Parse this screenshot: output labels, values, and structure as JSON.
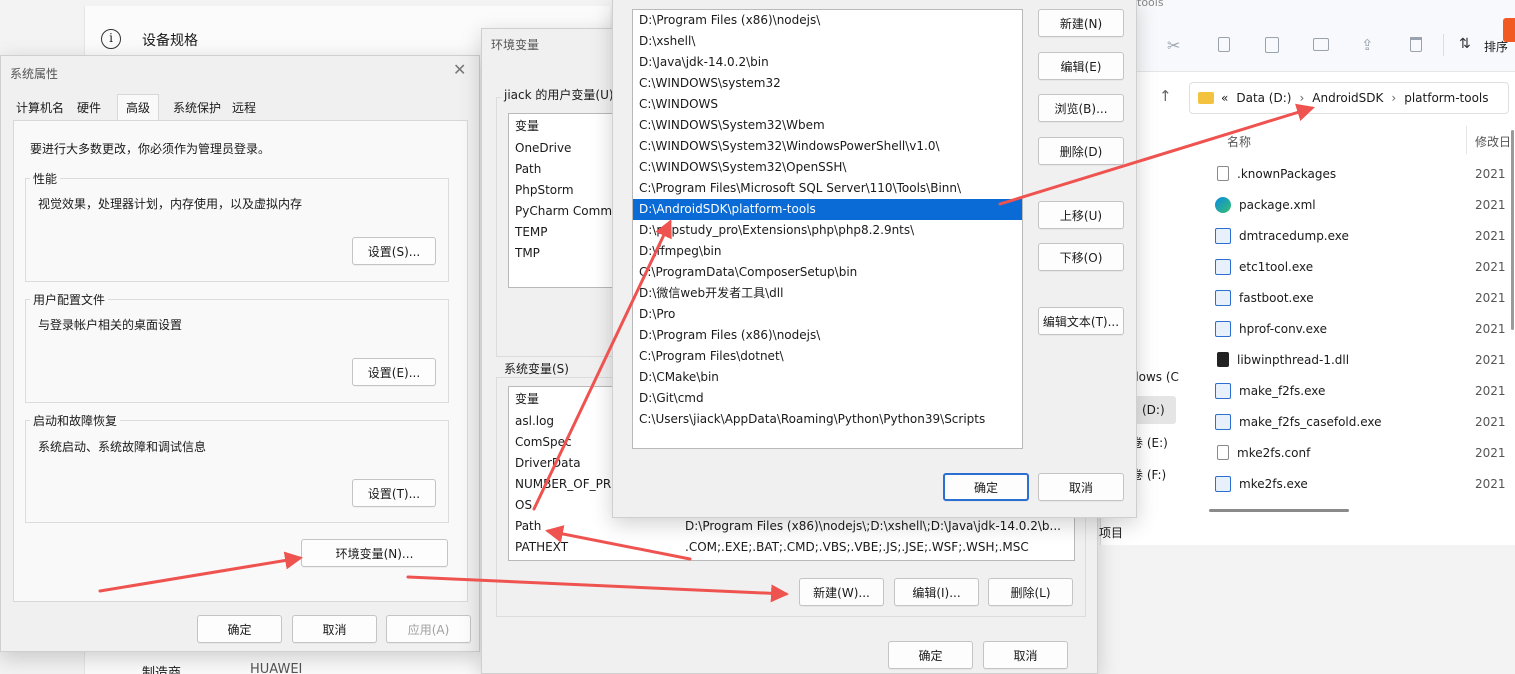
{
  "settings_bg": {
    "title": "设备规格",
    "bottom_label": "制造商",
    "bottom_value": "HUAWEI"
  },
  "explorer": {
    "title_fragment": "tools",
    "sort_label": "排序",
    "address": {
      "prefix": "«",
      "items": [
        "Data (D:)",
        "AndroidSDK",
        "platform-tools"
      ]
    },
    "columns": {
      "name": "名称",
      "modified": "修改日"
    },
    "files": [
      {
        "name": ".knownPackages",
        "date": "2021",
        "icon": "file-icon"
      },
      {
        "name": "package.xml",
        "date": "2021",
        "icon": "edge-icon"
      },
      {
        "name": "dmtracedump.exe",
        "date": "2021",
        "icon": "exe-icon"
      },
      {
        "name": "etc1tool.exe",
        "date": "2021",
        "icon": "exe-icon"
      },
      {
        "name": "fastboot.exe",
        "date": "2021",
        "icon": "exe-icon"
      },
      {
        "name": "hprof-conv.exe",
        "date": "2021",
        "icon": "exe-icon"
      },
      {
        "name": "libwinpthread-1.dll",
        "date": "2021",
        "icon": "dll-icon"
      },
      {
        "name": "make_f2fs.exe",
        "date": "2021",
        "icon": "exe-icon"
      },
      {
        "name": "make_f2fs_casefold.exe",
        "date": "2021",
        "icon": "exe-icon"
      },
      {
        "name": "mke2fs.conf",
        "date": "2021",
        "icon": "file-icon"
      },
      {
        "name": "mke2fs.exe",
        "date": "2021",
        "icon": "exe-icon"
      }
    ],
    "nav_fragments": [
      "dows (C",
      "(D:)",
      "卷 (E:)",
      "卷 (F:)"
    ],
    "status_fragment": "项目"
  },
  "sysprops": {
    "title": "系统属性",
    "tabs": [
      "计算机名",
      "硬件",
      "高级",
      "系统保护",
      "远程"
    ],
    "active_tab": 2,
    "admin_note": "要进行大多数更改，你必须作为管理员登录。",
    "perf": {
      "label": "性能",
      "desc": "视觉效果，处理器计划，内存使用，以及虚拟内存",
      "button": "设置(S)..."
    },
    "profile": {
      "label": "用户配置文件",
      "desc": "与登录帐户相关的桌面设置",
      "button": "设置(E)..."
    },
    "startup": {
      "label": "启动和故障恢复",
      "desc": "系统启动、系统故障和调试信息",
      "button": "设置(T)..."
    },
    "env_button": "环境变量(N)...",
    "ok": "确定",
    "cancel": "取消",
    "apply": "应用(A)"
  },
  "envvars": {
    "title": "环境变量",
    "user_label": "jiack 的用户变量(U)",
    "user_header": "变量",
    "user_vars": [
      "OneDrive",
      "Path",
      "PhpStorm",
      "PyCharm Commu",
      "TEMP",
      "TMP"
    ],
    "sys_label": "系统变量(S)",
    "sys_header": "变量",
    "sys_vars": [
      {
        "name": "asl.log",
        "value": ""
      },
      {
        "name": "ComSpec",
        "value": ""
      },
      {
        "name": "DriverData",
        "value": ""
      },
      {
        "name": "NUMBER_OF_PR",
        "value": ""
      },
      {
        "name": "OS",
        "value": ""
      },
      {
        "name": "Path",
        "value": "D:\\Program Files (x86)\\nodejs\\;D:\\xshell\\;D:\\Java\\jdk-14.0.2\\b..."
      },
      {
        "name": "PATHEXT",
        "value": ".COM;.EXE;.BAT;.CMD;.VBS;.VBE;.JS;.JSE;.WSF;.WSH;.MSC"
      }
    ],
    "new": "新建(W)...",
    "edit": "编辑(I)...",
    "delete": "删除(L)",
    "ok": "确定",
    "cancel": "取消"
  },
  "editpath": {
    "entries": [
      "D:\\Program Files (x86)\\nodejs\\",
      "D:\\xshell\\",
      "D:\\Java\\jdk-14.0.2\\bin",
      "C:\\WINDOWS\\system32",
      "C:\\WINDOWS",
      "C:\\WINDOWS\\System32\\Wbem",
      "C:\\WINDOWS\\System32\\WindowsPowerShell\\v1.0\\",
      "C:\\WINDOWS\\System32\\OpenSSH\\",
      "C:\\Program Files\\Microsoft SQL Server\\110\\Tools\\Binn\\",
      "D:\\AndroidSDK\\platform-tools",
      "D:\\phpstudy_pro\\Extensions\\php\\php8.2.9nts\\",
      "D:\\ffmpeg\\bin",
      "C:\\ProgramData\\ComposerSetup\\bin",
      "D:\\微信web开发者工具\\dll",
      "D:\\Pro",
      "D:\\Program Files (x86)\\nodejs\\",
      "C:\\Program Files\\dotnet\\",
      "D:\\CMake\\bin",
      "D:\\Git\\cmd",
      "C:\\Users\\jiack\\AppData\\Roaming\\Python\\Python39\\Scripts"
    ],
    "selected_index": 9,
    "buttons": {
      "new": "新建(N)",
      "edit": "编辑(E)",
      "browse": "浏览(B)...",
      "delete": "删除(D)",
      "up": "上移(U)",
      "down": "下移(O)",
      "edit_text": "编辑文本(T)..."
    },
    "ok": "确定",
    "cancel": "取消"
  },
  "colors": {
    "arrow": "#ef5350",
    "selection": "#0a6ad6",
    "primary_border": "#2a6fd1"
  }
}
